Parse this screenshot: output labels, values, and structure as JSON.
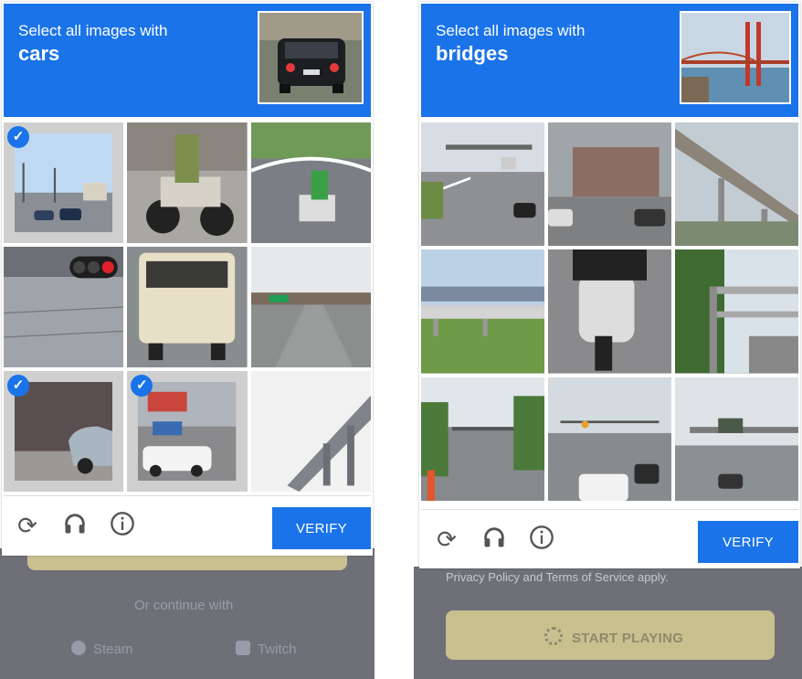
{
  "left_captcha": {
    "instruction": "Select all images with",
    "target": "cars",
    "verify_label": "VERIFY",
    "tiles": [
      {
        "selected": true
      },
      {
        "selected": false
      },
      {
        "selected": false
      },
      {
        "selected": false
      },
      {
        "selected": false
      },
      {
        "selected": false
      },
      {
        "selected": true
      },
      {
        "selected": true
      },
      {
        "selected": false
      }
    ],
    "background": {
      "or_continue": "Or continue with",
      "steam": "Steam",
      "twitch": "Twitch"
    }
  },
  "right_captcha": {
    "instruction": "Select all images with",
    "target": "bridges",
    "verify_label": "VERIFY",
    "tiles": [
      {
        "selected": false
      },
      {
        "selected": false
      },
      {
        "selected": false
      },
      {
        "selected": false
      },
      {
        "selected": false
      },
      {
        "selected": false
      },
      {
        "selected": false
      },
      {
        "selected": false
      },
      {
        "selected": false
      }
    ],
    "background": {
      "privacy": "Privacy Policy and Terms of Service apply.",
      "start_playing": "START PLAYING"
    }
  },
  "icons": [
    "reload-icon",
    "audio-icon",
    "info-icon"
  ],
  "colors": {
    "accent": "#1a73e8",
    "background_app": "#6f6f78",
    "cta_yellow": "#d9cf93"
  }
}
